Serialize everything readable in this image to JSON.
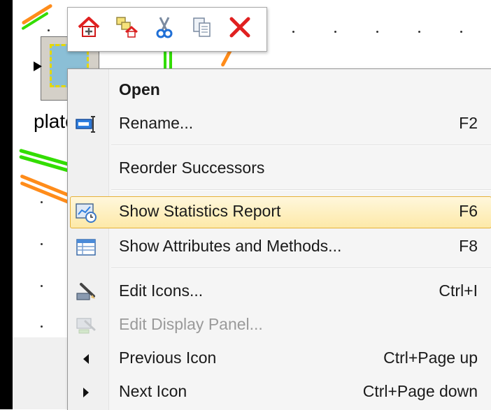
{
  "canvas": {
    "object_label": "plate"
  },
  "toolbar": {
    "buttons": [
      {
        "name": "open-location-button",
        "icon": "house-open-icon"
      },
      {
        "name": "open-in-new-window-button",
        "icon": "house-frames-icon"
      },
      {
        "name": "cut-button",
        "icon": "scissors-icon"
      },
      {
        "name": "copy-button",
        "icon": "copy-icon"
      },
      {
        "name": "delete-button",
        "icon": "red-x-icon"
      }
    ]
  },
  "menu": {
    "open": {
      "label": "Open"
    },
    "rename": {
      "label": "Rename...",
      "shortcut": "F2"
    },
    "reorder_successors": {
      "label": "Reorder Successors"
    },
    "show_statistics_report": {
      "label": "Show Statistics Report",
      "shortcut": "F6"
    },
    "show_attributes_and_methods": {
      "label": "Show Attributes and Methods...",
      "shortcut": "F8"
    },
    "edit_icons": {
      "label": "Edit Icons...",
      "shortcut": "Ctrl+I"
    },
    "edit_display_panel": {
      "label": "Edit Display Panel..."
    },
    "previous_icon": {
      "label": "Previous Icon",
      "shortcut": "Ctrl+Page up"
    },
    "next_icon": {
      "label": "Next Icon",
      "shortcut": "Ctrl+Page down"
    }
  },
  "colors": {
    "highlight_fill": "#fde9a8",
    "highlight_border": "#e5b13a",
    "menu_bg": "#f5f5f5",
    "wire_green": "#33dd00",
    "wire_orange": "#ff8c1a",
    "delete_red": "#e02020"
  }
}
